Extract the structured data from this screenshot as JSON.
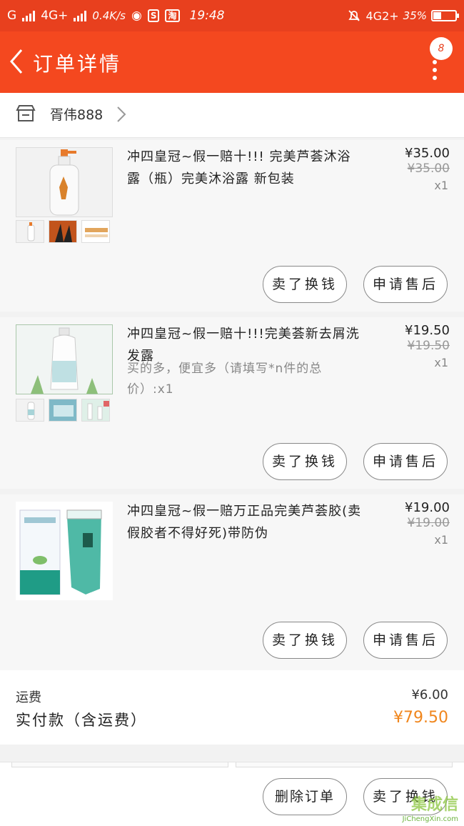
{
  "status_bar": {
    "carrier_left": "G",
    "network_left": "4G+",
    "speed": "0.4K/s",
    "time": "19:48",
    "network_right": "4G2+",
    "battery": "35%",
    "app_badge_1": "S",
    "app_badge_2": "淘"
  },
  "header": {
    "title": "订单详情",
    "message_count": "8"
  },
  "shop": {
    "name": "胥伟888"
  },
  "items": [
    {
      "name": "冲四皇冠~假一赔十!!! 完美芦荟沐浴露（瓶）完美沐浴露 新包装",
      "spec": "",
      "price": "¥35.00",
      "original_price": "¥35.00",
      "quantity": "x1",
      "button_left": "卖了换钱",
      "button_right": "申请售后"
    },
    {
      "name": "冲四皇冠~假一赔十!!!完美荟新去屑洗发露",
      "spec": "买的多，便宜多（请填写*n件的总价）:x1",
      "price": "¥19.50",
      "original_price": "¥19.50",
      "quantity": "x1",
      "button_left": "卖了换钱",
      "button_right": "申请售后"
    },
    {
      "name": "冲四皇冠~假一赔万正品完美芦荟胶(卖假胶者不得好死)带防伪",
      "spec": "",
      "price": "¥19.00",
      "original_price": "¥19.00",
      "quantity": "x1",
      "button_left": "卖了换钱",
      "button_right": "申请售后"
    }
  ],
  "summary": {
    "shipping_label": "运费",
    "shipping_value": "¥6.00",
    "paid_label": "实付款（含运费）",
    "paid_value": "¥79.50"
  },
  "bottom_bar": {
    "delete_label": "删除订单",
    "sell_label": "卖了换钱"
  },
  "watermark": {
    "text": "JiChengXin.com",
    "logo_text": "集成信"
  },
  "colors": {
    "accent": "#f4481f",
    "price_highlight": "#f0861d"
  }
}
